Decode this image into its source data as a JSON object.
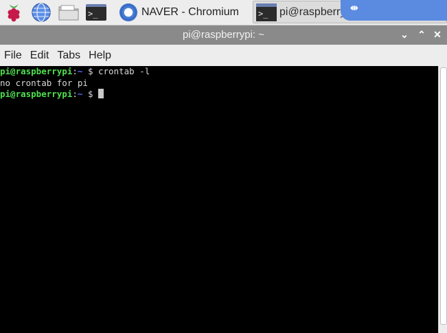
{
  "taskbar": {
    "launchers": [
      {
        "name": "raspberry-menu-icon"
      },
      {
        "name": "web-browser-icon"
      },
      {
        "name": "file-manager-icon"
      },
      {
        "name": "terminal-launcher-icon",
        "glyph": ">_"
      }
    ],
    "tasks": [
      {
        "label": "NAVER - Chromium",
        "icon": "chromium-icon"
      },
      {
        "label": "pi@raspberrypi: ~",
        "icon": "terminal-icon",
        "glyph": ">_"
      }
    ]
  },
  "window": {
    "title": "pi@raspberrypi: ~",
    "controls": {
      "minimize": "⌄",
      "maximize": "⌃",
      "close": "✕"
    }
  },
  "menubar": {
    "items": [
      "File",
      "Edit",
      "Tabs",
      "Help"
    ]
  },
  "terminal": {
    "lines": [
      {
        "user": "pi@raspberrypi",
        "sep": ":",
        "path": "~",
        "prompt": " $ ",
        "command": "crontab -l"
      },
      {
        "output": "no crontab for pi"
      },
      {
        "user": "pi@raspberrypi",
        "sep": ":",
        "path": "~",
        "prompt": " $ ",
        "command": ""
      }
    ]
  },
  "colors": {
    "prompt_user": "#4fe04f",
    "prompt_path": "#5a6cff",
    "terminal_bg": "#000000",
    "titlebar_bg": "#8a8a8a"
  }
}
